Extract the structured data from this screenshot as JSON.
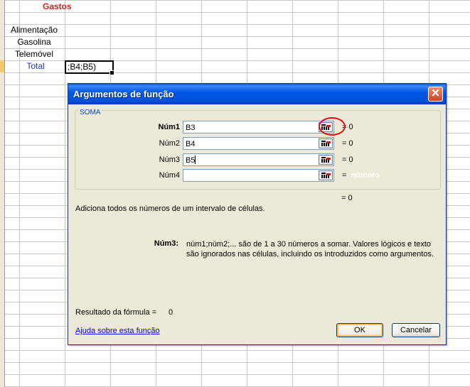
{
  "sheet": {
    "title": "Gastos",
    "rows": [
      "Alimentação",
      "Gasolina",
      "Telemóvel"
    ],
    "total_label": "Total",
    "active_cell_value": ";B4;B5)"
  },
  "dialog": {
    "title": "Argumentos de função",
    "close_glyph": "✕",
    "function_name": "SOMA",
    "args": [
      {
        "label": "Núm1",
        "value": "B3",
        "result": "= 0",
        "bold": true
      },
      {
        "label": "Núm2",
        "value": "B4",
        "result": "= 0"
      },
      {
        "label": "Núm3",
        "value": "B5",
        "result": "= 0"
      },
      {
        "label": "Núm4",
        "value": "",
        "result_eq": "=",
        "result": "número"
      }
    ],
    "overall_result": "= 0",
    "description": "Adiciona todos os números de um intervalo de células.",
    "help_arg_label": "Núm3:",
    "help_arg_text": "núm1;núm2;... são de 1 a 30 números a somar. Valores lógicos e texto são ignorados nas células, incluindo os introduzidos como argumentos.",
    "result_label": "Resultado da fórmula =",
    "result_value": "0",
    "help_link": "Ajuda sobre esta função",
    "ok_label": "OK",
    "cancel_label": "Cancelar"
  }
}
